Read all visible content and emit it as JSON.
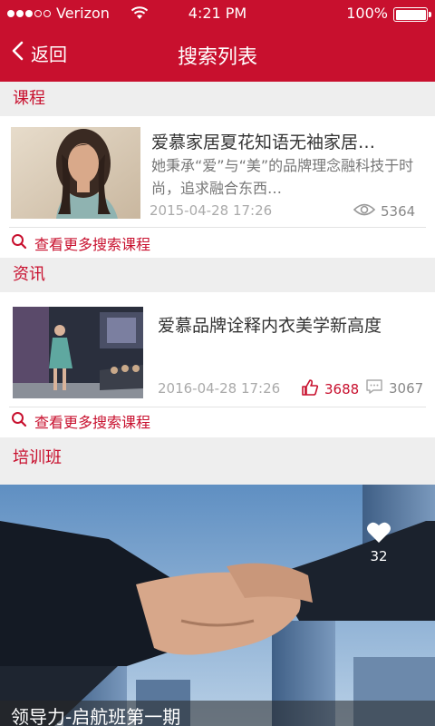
{
  "status_bar": {
    "carrier": "Verizon",
    "time": "4:21 PM",
    "battery": "100%",
    "signal_bars": 3,
    "signal_total": 5
  },
  "nav": {
    "back_label": "返回",
    "title": "搜索列表"
  },
  "sections": {
    "course": {
      "heading": "课程",
      "item": {
        "title": "爱慕家居夏花知语无袖家居…",
        "desc": "她秉承“爱”与“美”的品牌理念融科技于时尚，追求融合东西…",
        "date": "2015-04-28 17:26",
        "views": "5364"
      },
      "more_label": "查看更多搜索课程"
    },
    "news": {
      "heading": "资讯",
      "item": {
        "title": "爱慕品牌诠释内衣美学新高度",
        "date": "2016-04-28 17:26",
        "likes": "3688",
        "comments": "3067"
      },
      "more_label": "查看更多搜索课程"
    },
    "training": {
      "heading": "培训班",
      "banner": {
        "likes": "32",
        "caption": "领导力-启航班第一期"
      }
    }
  },
  "colors": {
    "brand_red": "#c8102e",
    "section_bg": "#eeeeee"
  },
  "icons": [
    "back-chevron-icon",
    "wifi-icon",
    "eye-icon",
    "thumbs-up-icon",
    "comment-icon",
    "search-icon",
    "heart-icon"
  ]
}
